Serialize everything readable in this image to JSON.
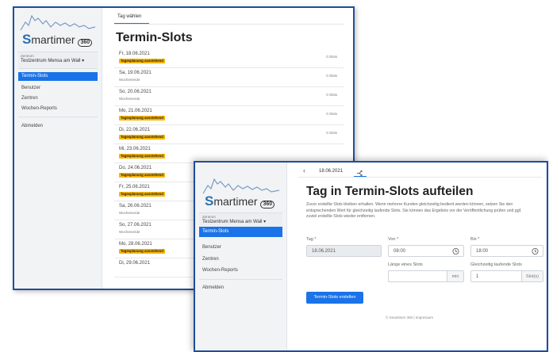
{
  "back_window": {
    "logo": {
      "text": "martimer",
      "first_letter": "S",
      "badge": "360"
    },
    "center": {
      "label": "Zentrum",
      "value": "Testzentrum Mensa am Wall ▾"
    },
    "nav": {
      "termin_slots": "Termin-Slots",
      "benutzer": "Benutzer",
      "zentren": "Zentren",
      "wochen_reports": "Wochen-Reports",
      "abmelden": "Abmelden"
    },
    "tab": "Tag wählen",
    "title": "Termin-Slots",
    "rows": [
      {
        "date": "Fr, 18.06.2021",
        "badge": "Tagesplanung ausstehend",
        "sub": "",
        "slots": "0 Slots"
      },
      {
        "date": "Sa, 19.06.2021",
        "badge": "",
        "sub": "Wochenende",
        "slots": "0 Slots"
      },
      {
        "date": "So, 20.06.2021",
        "badge": "",
        "sub": "Wochenende",
        "slots": "0 Slots"
      },
      {
        "date": "Mo, 21.06.2021",
        "badge": "Tagesplanung ausstehend",
        "sub": "",
        "slots": "0 Slots"
      },
      {
        "date": "Di, 22.06.2021",
        "badge": "Tagesplanung ausstehend",
        "sub": "",
        "slots": "0 Slots"
      },
      {
        "date": "Mi, 23.06.2021",
        "badge": "Tagesplanung ausstehend",
        "sub": "",
        "slots": ""
      },
      {
        "date": "Do, 24.06.2021",
        "badge": "Tagesplanung ausstehend",
        "sub": "",
        "slots": ""
      },
      {
        "date": "Fr, 25.06.2021",
        "badge": "Tagesplanung ausstehend",
        "sub": "",
        "slots": ""
      },
      {
        "date": "Sa, 26.06.2021",
        "badge": "",
        "sub": "Wochenende",
        "slots": ""
      },
      {
        "date": "So, 27.06.2021",
        "badge": "",
        "sub": "Wochenende",
        "slots": ""
      },
      {
        "date": "Mo, 28.06.2021",
        "badge": "Tagesplanung ausstehend",
        "sub": "",
        "slots": ""
      },
      {
        "date": "Di, 29.06.2021",
        "badge": "",
        "sub": "",
        "slots": ""
      }
    ]
  },
  "front_window": {
    "logo": {
      "text": "martimer",
      "first_letter": "S",
      "badge": "360"
    },
    "center": {
      "label": "Zentrum",
      "value": "Testzentrum Mensa am Wall ▾"
    },
    "nav": {
      "termin_slots": "Termin-Slots",
      "benutzer": "Benutzer",
      "zentren": "Zentren",
      "wochen_reports": "Wochen-Reports",
      "abmelden": "Abmelden"
    },
    "breadcrumb": {
      "back_icon": "chevron-left-icon",
      "date": "18.06.2021",
      "split_icon": "split-arrows-icon"
    },
    "title": "Tag in Termin-Slots aufteilen",
    "description": "Zuvor erstellte Slots bleiben erhalten. Wenn mehrere Kunden gleichzeitig bedient werden können, setzen Sie den entsprechenden Wert für gleichzeitig laufende Slots. Sie können das Ergebnis vor der Veröffentlichung prüfen und ggf. zuviel erstellte Slots wieder entfernen.",
    "form": {
      "tag_label": "Tag *",
      "tag_value": "18.06.2021",
      "von_label": "Von *",
      "von_value": "08:00",
      "bis_label": "Bis *",
      "bis_value": "18:00",
      "laenge_label": "Länge eines Slots",
      "laenge_value": "",
      "laenge_unit": "min",
      "gleichzeitig_label": "Gleichzeitig laufende Slots",
      "gleichzeitig_value": "1",
      "gleichzeitig_unit": "Slot(s)"
    },
    "button": "Termin-Slots erstellen",
    "footer": "© Smartimer 360 | Impressum"
  },
  "colors": {
    "accent": "#1a73e8",
    "badge": "#f6b400",
    "window_border": "#1f4e9c"
  }
}
